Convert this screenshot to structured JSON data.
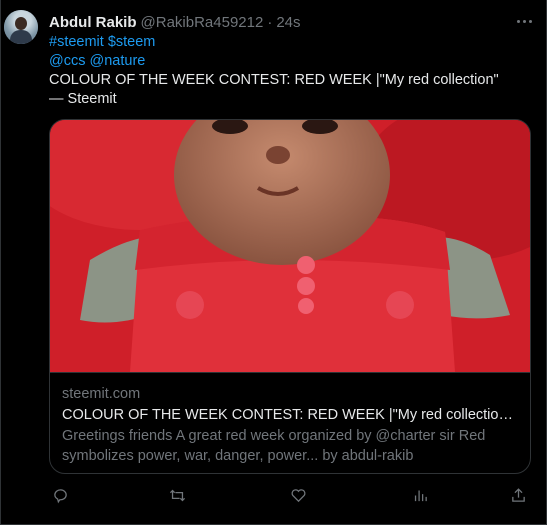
{
  "author": {
    "name": "Abdul Rakib",
    "handle": "@RakibRa459212",
    "separator": "·",
    "time": "24s"
  },
  "tweet": {
    "line1": "#steemit $steem",
    "line2": "@ccs @nature",
    "text": "COLOUR OF THE WEEK CONTEST: RED WEEK |\"My red collection\" — Steemit"
  },
  "card": {
    "domain": "steemit.com",
    "title": "COLOUR OF THE WEEK CONTEST: RED WEEK |\"My red collection\" — ...",
    "description": "Greetings friends A great red week organized by @charter sir Red symbolizes power, war, danger, power... by abdul-rakib"
  },
  "icons": {
    "more": "more-horizontal-icon",
    "reply": "reply-icon",
    "retweet": "retweet-icon",
    "like": "heart-icon",
    "views": "bar-chart-icon",
    "share": "share-icon"
  },
  "colors": {
    "background": "#000000",
    "text": "#e7e9ea",
    "muted": "#71767b",
    "link": "#1d9bf0",
    "border": "#2f3336"
  }
}
